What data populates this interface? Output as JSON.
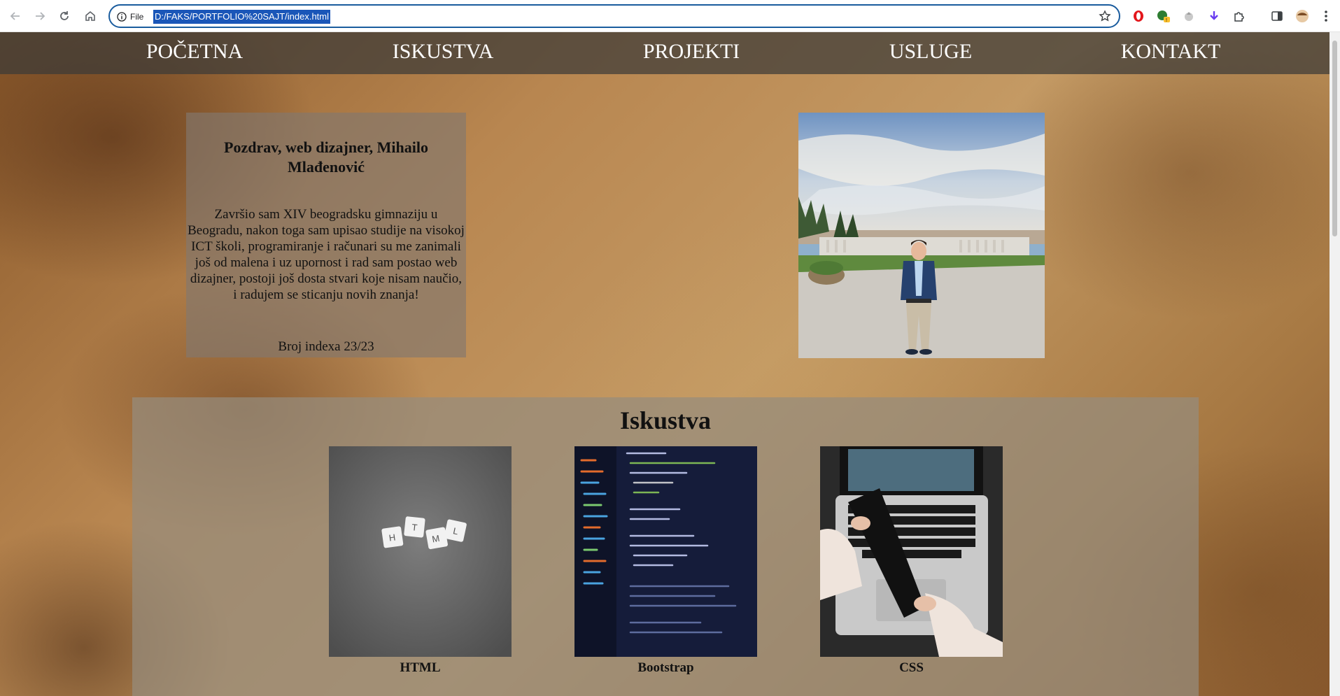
{
  "browser": {
    "site_info_label": "File",
    "url": "D:/FAKS/PORTFOLIO%20SAJT/index.html",
    "icons": [
      "back-icon",
      "forward-icon",
      "reload-icon",
      "home-icon",
      "info-icon",
      "star-icon",
      "opera-icon",
      "extension-badge-icon",
      "extension-icon",
      "download-icon",
      "puzzle-icon",
      "sidebar-icon",
      "profile-icon",
      "menu-icon"
    ]
  },
  "nav": {
    "items": [
      {
        "label": "POČETNA"
      },
      {
        "label": "ISKUSTVA"
      },
      {
        "label": "PROJEKTI"
      },
      {
        "label": "USLUGE"
      },
      {
        "label": "KONTAKT"
      }
    ]
  },
  "intro": {
    "title": "Pozdrav, web dizajner, Mihailo Mlađenović",
    "text": "Završio sam XIV beogradsku gimnaziju u Beogradu, nakon toga sam upisao studije na visokoj ICT školi, programiranje i računari su me zanimali još od malena i uz upornost i rad sam postao web dizajner, postoji još dosta stvari koje nisam naučio, i radujem se sticanju novih znanja!",
    "index_number": "Broj indexa 23/23"
  },
  "experience": {
    "title": "Iskustva",
    "cards": [
      {
        "label": "HTML",
        "image": "html-scrabble-tiles-photo"
      },
      {
        "label": "Bootstrap",
        "image": "code-editor-screen-photo"
      },
      {
        "label": "CSS",
        "image": "laptop-film-roll-photo"
      }
    ]
  },
  "colors": {
    "accent_url_highlight": "#1a56b8",
    "omnibox_border": "#1a5c9e",
    "nav_text": "#ffffff"
  }
}
